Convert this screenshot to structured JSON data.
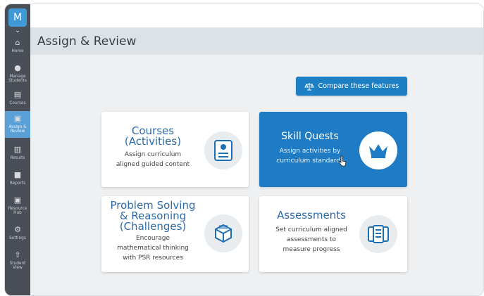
{
  "app": {
    "logo_letter": "M"
  },
  "sidebar": {
    "items": [
      {
        "label": "Home",
        "icon": "home-icon"
      },
      {
        "label": "Manage Students",
        "icon": "students-icon"
      },
      {
        "label": "Courses",
        "icon": "courses-icon"
      },
      {
        "label": "Assign & Review",
        "icon": "assign-icon",
        "active": true
      },
      {
        "label": "Results",
        "icon": "results-icon"
      },
      {
        "label": "Reports",
        "icon": "reports-icon"
      },
      {
        "label": "Resource Hub",
        "icon": "resource-icon"
      },
      {
        "label": "Settings",
        "icon": "gear-icon"
      },
      {
        "label": "Student View",
        "icon": "student-view-icon"
      }
    ]
  },
  "header": {
    "title": "Assign & Review"
  },
  "compare": {
    "label": "Compare these features"
  },
  "cards": {
    "courses": {
      "title_line1": "Courses",
      "title_line2": "(Activities)",
      "desc_line1": "Assign curriculum",
      "desc_line2": "aligned guided content"
    },
    "skill_quests": {
      "title": "Skill Quests",
      "desc_line1": "Assign activities by",
      "desc_line2": "curriculum standards"
    },
    "problem_solving": {
      "title_line1": "Problem Solving",
      "title_line2": "& Reasoning",
      "title_line3": "(Challenges)",
      "desc_line1": "Encourage",
      "desc_line2": "mathematical thinking",
      "desc_line3": "with PSR resources"
    },
    "assessments": {
      "title": "Assessments",
      "desc_line1": "Set curriculum aligned",
      "desc_line2": "assessments to",
      "desc_line3": "measure progress"
    }
  },
  "colors": {
    "accent": "#1f7cc4",
    "sidebar": "#4a4f57",
    "active": "#5a9fd6",
    "title_blue": "#2d6bab"
  }
}
